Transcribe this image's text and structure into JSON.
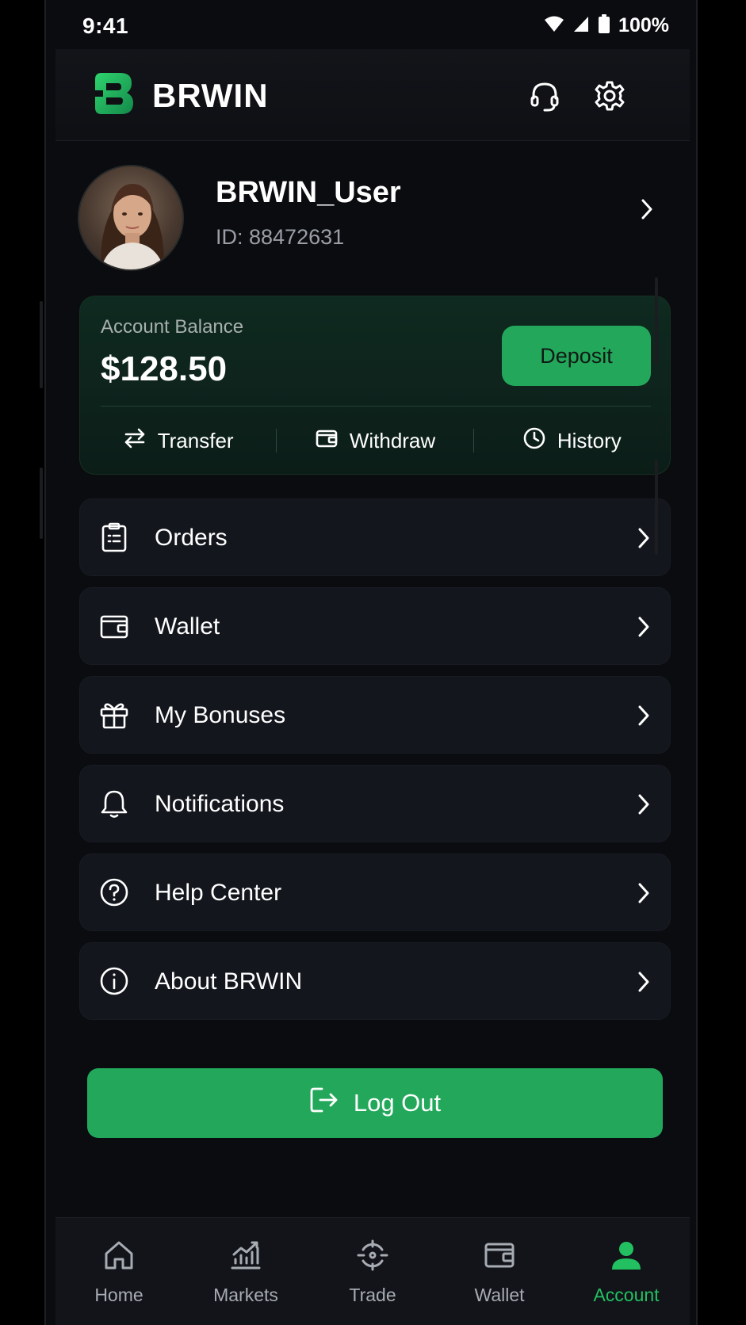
{
  "status_bar": {
    "time": "9:41",
    "battery_pct": "100%"
  },
  "header": {
    "brand": "BRWIN",
    "support_icon": "headset-icon",
    "settings_icon": "gear-icon"
  },
  "profile": {
    "username": "BRWIN_User",
    "user_id": "ID: 88472631"
  },
  "balance": {
    "label": "Account Balance",
    "amount": "$128.50",
    "deposit_label": "Deposit",
    "actions": [
      {
        "label": "Transfer",
        "icon": "transfer-icon"
      },
      {
        "label": "Withdraw",
        "icon": "wallet-icon"
      },
      {
        "label": "History",
        "icon": "clock-icon"
      }
    ]
  },
  "menu": [
    {
      "label": "Orders",
      "icon": "clipboard-icon"
    },
    {
      "label": "Wallet",
      "icon": "wallet-icon"
    },
    {
      "label": "My Bonuses",
      "icon": "gift-icon"
    },
    {
      "label": "Notifications",
      "icon": "bell-icon"
    },
    {
      "label": "Help Center",
      "icon": "question-icon"
    },
    {
      "label": "About BRWIN",
      "icon": "info-icon"
    }
  ],
  "logout_label": "Log Out",
  "bottom_nav": [
    {
      "label": "Home",
      "icon": "home-icon",
      "active": false
    },
    {
      "label": "Markets",
      "icon": "chart-icon",
      "active": false
    },
    {
      "label": "Trade",
      "icon": "trade-icon",
      "active": false
    },
    {
      "label": "Wallet",
      "icon": "wallet-icon",
      "active": false
    },
    {
      "label": "Account",
      "icon": "user-icon",
      "active": true
    }
  ],
  "colors": {
    "accent": "#23a85b",
    "accent_active": "#23c062",
    "background": "#0b0c10",
    "card": "#14161e"
  }
}
